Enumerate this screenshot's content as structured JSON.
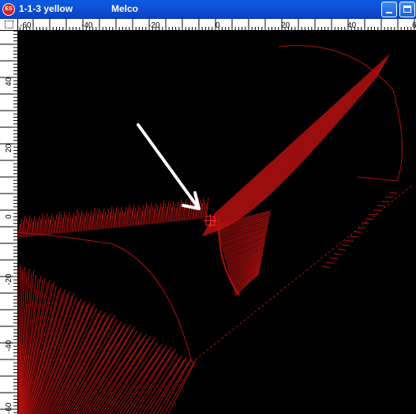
{
  "window": {
    "file_title": "1-1-3 yellow",
    "app_title": "Melco",
    "icon_label": "ES"
  },
  "rulers": {
    "horizontal_labels": [
      "-60",
      "-40",
      "-20",
      "0",
      "20",
      "40",
      "60"
    ],
    "vertical_labels": [
      "40",
      "20",
      "0",
      "-20",
      "-40",
      "-60"
    ]
  },
  "colors": {
    "titlebar": "#0a4fd6",
    "stitch": "#b01010",
    "canvas": "#000000",
    "arrow": "#ffffff"
  },
  "icons": {
    "app": "es-logo-icon",
    "minimize": "minimize-icon",
    "maximize": "maximize-icon",
    "pointer": "arrow-icon",
    "origin": "origin-marker-icon"
  }
}
